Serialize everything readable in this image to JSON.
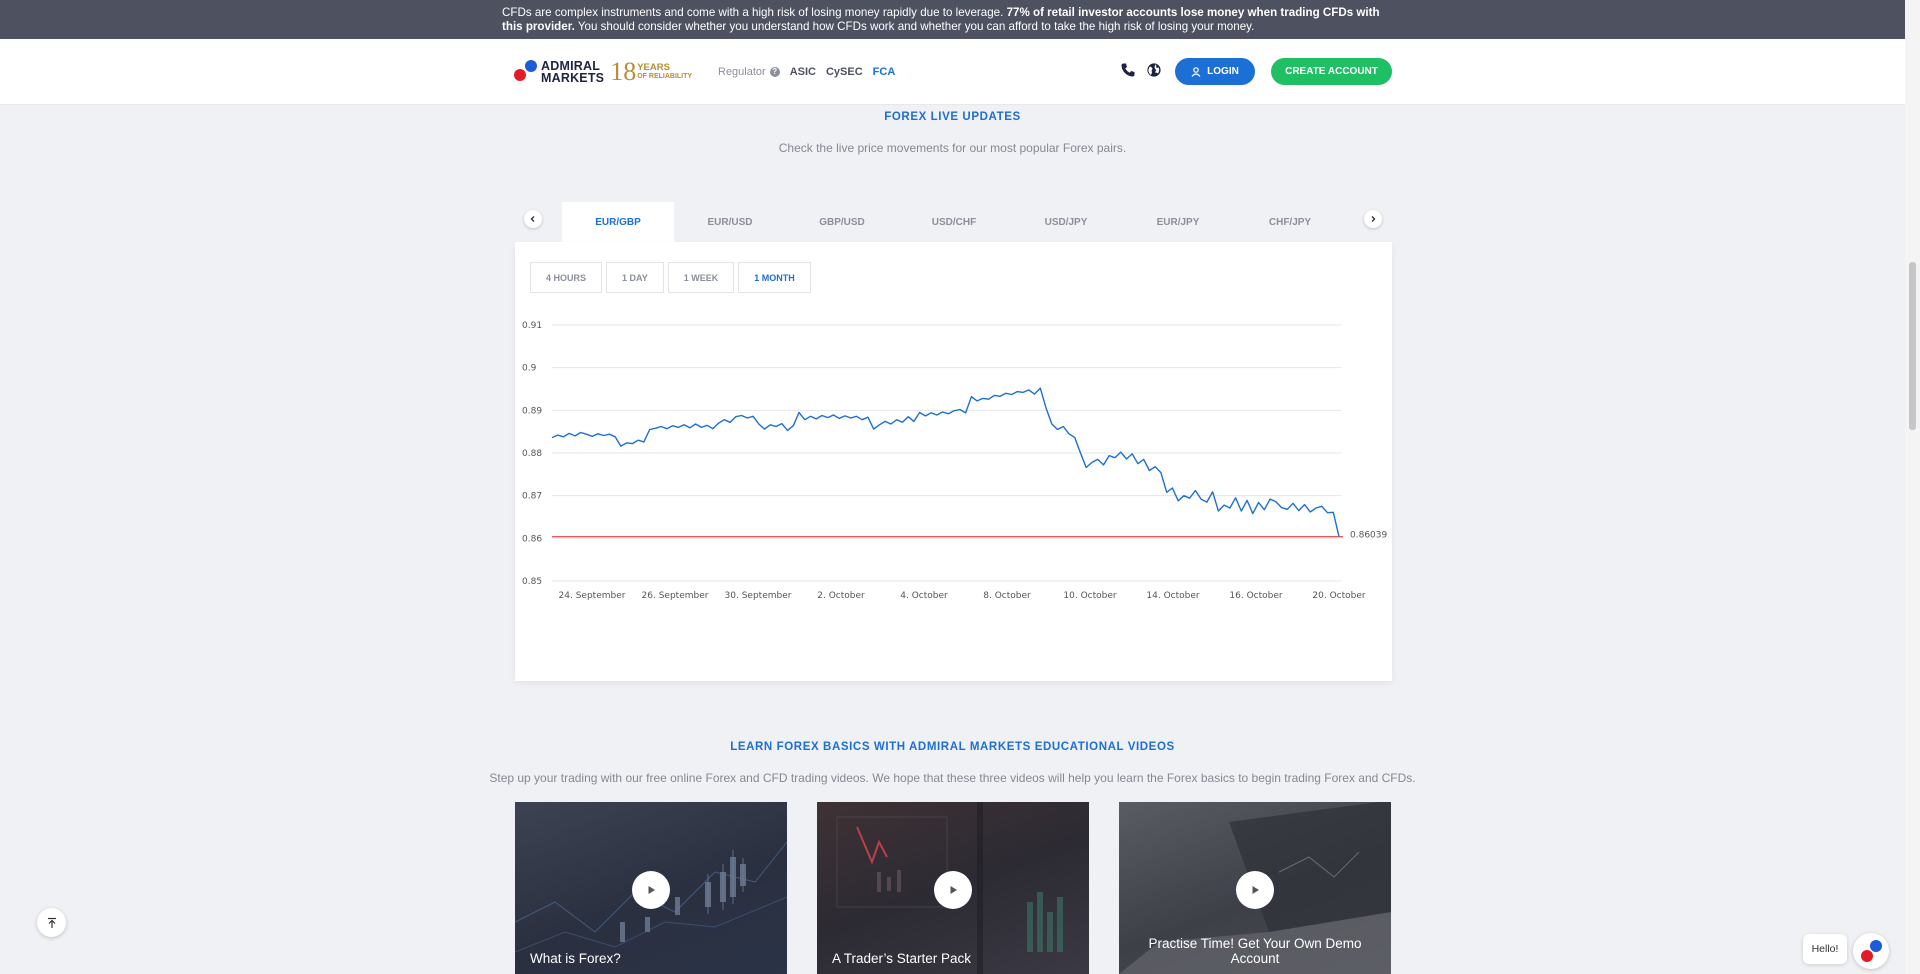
{
  "risk_banner": {
    "text_start": "CFDs are complex instruments and come with a high risk of losing money rapidly due to leverage. ",
    "text_bold": "77% of retail investor accounts lose money when trading CFDs with this provider.",
    "text_end": " You should consider whether you understand how CFDs work and whether you can afford to take the high risk of losing your money."
  },
  "header": {
    "logo_line1": "ADMIRAL",
    "logo_line2": "MARKETS",
    "years_num": "18",
    "years_word": "YEARS",
    "years_sub": "OF RELIABILITY",
    "regulator_label": "Regulator",
    "regulators": [
      "ASIC",
      "CySEC",
      "FCA"
    ],
    "login_label": "LOGIN",
    "create_label": "CREATE ACCOUNT"
  },
  "forex": {
    "title": "FOREX LIVE UPDATES",
    "subtitle": "Check the live price movements for our most popular Forex pairs.",
    "tabs": [
      "EUR/GBP",
      "EUR/USD",
      "GBP/USD",
      "USD/CHF",
      "USD/JPY",
      "EUR/JPY",
      "CHF/JPY"
    ],
    "active_tab": 0,
    "periods": [
      "4 HOURS",
      "1 DAY",
      "1 WEEK",
      "1 MONTH"
    ],
    "active_period": 3
  },
  "chart_data": {
    "type": "line",
    "y_ticks": [
      "0.91",
      "0.9",
      "0.89",
      "0.88",
      "0.87",
      "0.86",
      "0.85"
    ],
    "ylim": [
      0.85,
      0.91
    ],
    "x_ticks": [
      "24. September",
      "26. September",
      "30. September",
      "2. October",
      "4. October",
      "8. October",
      "10. October",
      "14. October",
      "16. October",
      "20. October"
    ],
    "current_value": 0.86039,
    "current_label": "0.86039",
    "line_color": "#1c6fd4",
    "current_line_color": "#e5585e",
    "series": [
      {
        "values": [
          0.8836,
          0.8842,
          0.8838,
          0.8846,
          0.884,
          0.8848,
          0.8844,
          0.8839,
          0.8845,
          0.8841,
          0.8844,
          0.8838,
          0.8816,
          0.8824,
          0.8822,
          0.883,
          0.8826,
          0.8855,
          0.8858,
          0.8862,
          0.8857,
          0.8864,
          0.886,
          0.8866,
          0.8859,
          0.8868,
          0.886,
          0.8865,
          0.8857,
          0.887,
          0.8878,
          0.8872,
          0.8885,
          0.8888,
          0.8882,
          0.8886,
          0.8868,
          0.8856,
          0.8866,
          0.8862,
          0.8869,
          0.8853,
          0.8864,
          0.8895,
          0.8878,
          0.8886,
          0.888,
          0.8888,
          0.8883,
          0.8889,
          0.8881,
          0.8887,
          0.8882,
          0.8886,
          0.8878,
          0.8884,
          0.8856,
          0.8866,
          0.8874,
          0.8868,
          0.8878,
          0.8872,
          0.8885,
          0.8874,
          0.8895,
          0.8887,
          0.8894,
          0.8889,
          0.8896,
          0.8892,
          0.8899,
          0.8902,
          0.8894,
          0.8932,
          0.8922,
          0.8928,
          0.8926,
          0.8935,
          0.8933,
          0.894,
          0.8937,
          0.8944,
          0.8942,
          0.8948,
          0.8938,
          0.8952,
          0.8906,
          0.8868,
          0.8855,
          0.8862,
          0.8845,
          0.8836,
          0.88,
          0.8766,
          0.8778,
          0.8785,
          0.8772,
          0.8794,
          0.8789,
          0.8802,
          0.8786,
          0.8798,
          0.8775,
          0.8785,
          0.8759,
          0.8768,
          0.8754,
          0.8708,
          0.8718,
          0.8688,
          0.87,
          0.8694,
          0.8712,
          0.8692,
          0.8685,
          0.8709,
          0.8664,
          0.8678,
          0.8671,
          0.8695,
          0.8664,
          0.8689,
          0.8658,
          0.8684,
          0.8667,
          0.8692,
          0.8686,
          0.8672,
          0.8668,
          0.8682,
          0.8665,
          0.8679,
          0.8662,
          0.8671,
          0.8675,
          0.866,
          0.8661,
          0.8604
        ]
      }
    ]
  },
  "education": {
    "title": "LEARN FOREX BASICS WITH ADMIRAL MARKETS EDUCATIONAL VIDEOS",
    "subtitle": "Step up your trading with our free online Forex and CFD trading videos. We hope that these three videos will help you learn the Forex basics to begin trading Forex and CFDs.",
    "videos": [
      "What is Forex?",
      "A Trader’s Starter Pack",
      "Practise Time! Get Your Own Demo Account"
    ]
  },
  "chat": {
    "greeting": "Hello!"
  }
}
